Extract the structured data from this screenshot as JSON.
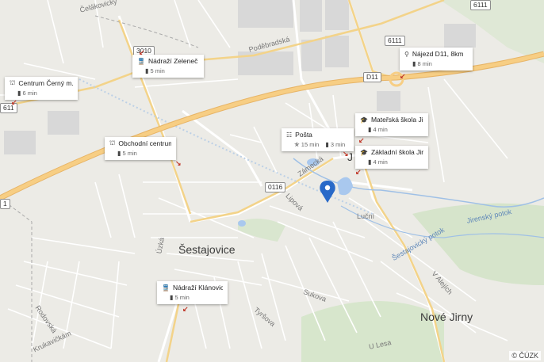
{
  "towns": {
    "sestajovice": "Šestajovice",
    "nove_jirny": "Nové Jirny",
    "jirny_partial": "J"
  },
  "streets": {
    "celakovicka": "Čelákovický",
    "podebradska": "Poděbradská",
    "lipova": "Lipová",
    "lucni": "Luční",
    "uzka": "Úzká",
    "sukova": "Sukova",
    "tyrsova": "Tyršova",
    "rodovska": "Rodovská",
    "krukavicka": "Krukavičkám",
    "u_lesa": "U Lesa",
    "v_alejich": "V Alejích",
    "zamecka": "Zámecká"
  },
  "water": {
    "jirensky_potok": "Jirenský potok",
    "sestajovicky_potok": "Šestajovický potok"
  },
  "road_badges": {
    "r3010": "3010",
    "r6111a": "6111",
    "r6111b": "6111",
    "d11": "D11",
    "r0116": "0116",
    "r611": "611",
    "r1": "1"
  },
  "pois": [
    {
      "title": "Nádraží Zeleneč",
      "icon": "train-icon",
      "times": [
        "5 min"
      ],
      "time_icons": [
        "car-icon"
      ]
    },
    {
      "title": "Nájezd D11, 8km",
      "icon": "pin-icon",
      "times": [
        "8 min"
      ],
      "time_icons": [
        "car-icon"
      ]
    },
    {
      "title": "Centrum Černý m...",
      "icon": "cart-icon",
      "times": [
        "6 min"
      ],
      "time_icons": [
        "car-icon"
      ]
    },
    {
      "title": "Mateřská škola Ji...",
      "icon": "school-icon",
      "times": [
        "4 min"
      ],
      "time_icons": [
        "car-icon"
      ]
    },
    {
      "title": "Pošta",
      "icon": "post-icon",
      "times": [
        "15 min",
        "3 min"
      ],
      "time_icons": [
        "walk-icon",
        "car-icon"
      ]
    },
    {
      "title": "Obchodní centrum",
      "icon": "cart-icon",
      "times": [
        "5 min"
      ],
      "time_icons": [
        "car-icon"
      ]
    },
    {
      "title": "Základní škola Jirny",
      "icon": "school-icon",
      "times": [
        "4 min"
      ],
      "time_icons": [
        "car-icon"
      ]
    },
    {
      "title": "Nádraží Klánovice",
      "icon": "train-icon",
      "times": [
        "5 min"
      ],
      "time_icons": [
        "car-icon"
      ]
    }
  ],
  "copyright": "© ČÚZK"
}
